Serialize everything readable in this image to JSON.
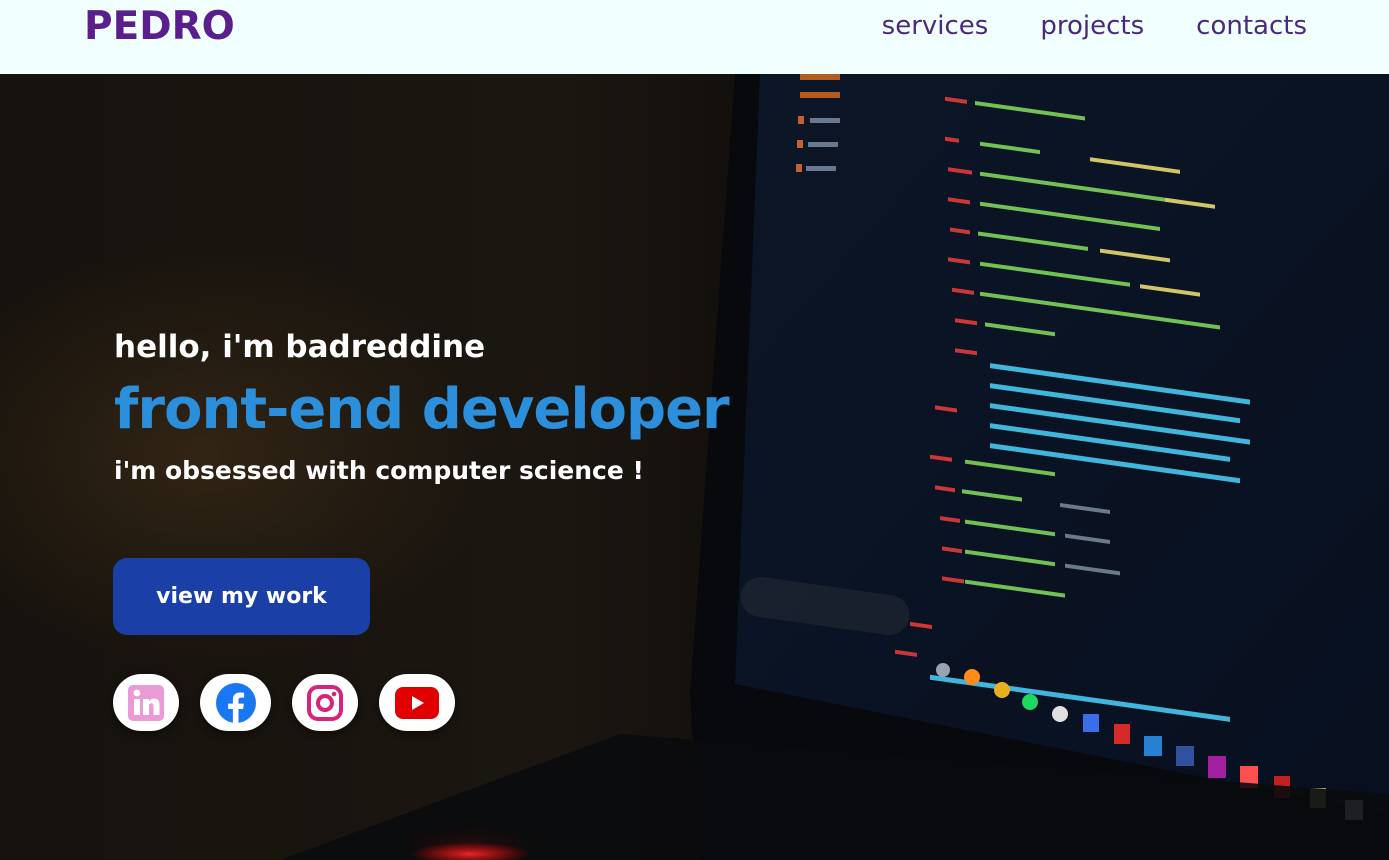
{
  "header": {
    "logo": "PEDRO",
    "nav": [
      {
        "label": "services"
      },
      {
        "label": "projects"
      },
      {
        "label": "contacts"
      }
    ]
  },
  "hero": {
    "greeting": "hello, i'm badreddine",
    "role": "front-end developer",
    "tagline": "i'm obsessed with computer science !",
    "cta_label": "view my work"
  },
  "socials": [
    {
      "name": "linkedin-icon",
      "color": "#ea9ad4"
    },
    {
      "name": "facebook-icon",
      "color": "#1877f2"
    },
    {
      "name": "instagram-icon",
      "color": "#d6247a"
    },
    {
      "name": "youtube-icon",
      "color": "#e00000"
    }
  ],
  "colors": {
    "header_bg": "#f0fffe",
    "logo": "#5a1f8c",
    "nav": "#4a2a7c",
    "role": "#2b8fdc",
    "cta_bg": "#1a40a8"
  }
}
